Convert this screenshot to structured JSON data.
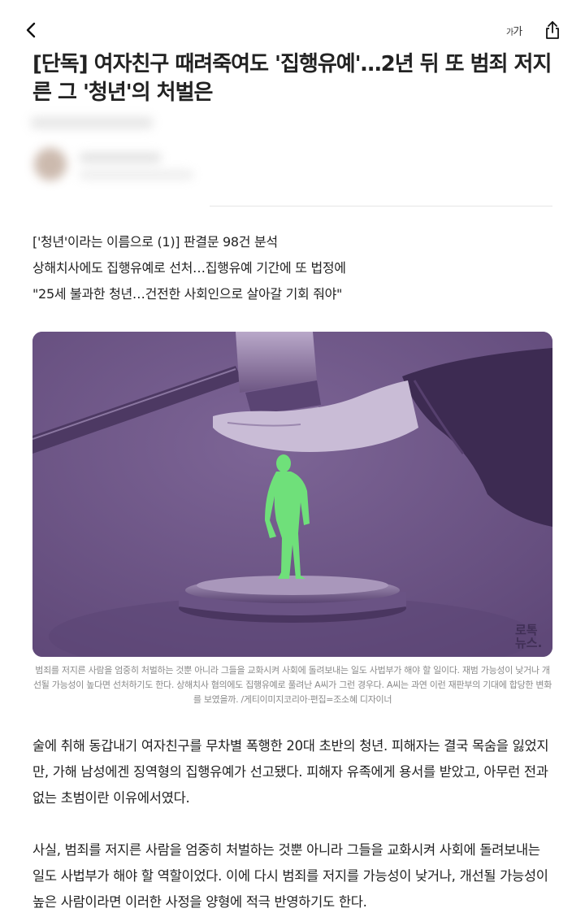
{
  "header": {
    "back_icon": "chevron-left-icon",
    "font_size_small": "가",
    "font_size_large": "가",
    "share_icon": "share-icon"
  },
  "article": {
    "title": "[단독] 여자친구 때려죽여도 '집행유예'…2년 뒤 또 범죄 저지른 그 '청년'의 처벌은",
    "subheadings": [
      "['청년'이라는 이름으로 (1)] 판결문 98건 분석",
      "상해치사에도 집행유예로 선처…집행유예 기간에 또 법정에",
      "\"25세 불과한 청년…건전한 사회인으로 살아갈 기회 줘야\""
    ],
    "image": {
      "watermark_line1": "로톡",
      "watermark_line2": "뉴스."
    },
    "caption": "범죄를 저지른 사람을 엄중히 처벌하는 것뿐 아니라 그들을 교화시켜 사회에 돌려보내는 일도 사법부가 해야 할 일이다. 재범 가능성이 낮거나 개선될 가능성이 높다면 선처하기도 한다. 상해치사 혐의에도 집행유예로 풀려난 A씨가 그런 경우다. A씨는 과연 이런 재판부의 기대에 합당한 변화를 보였을까. /게티이미지코리아·편집=조소혜 디자이너",
    "paragraphs": [
      "술에 취해 동갑내기 여자친구를 무차별 폭행한 20대 초반의 청년. 피해자는 결국 목숨을 잃었지만, 가해 남성에겐 징역형의 집행유예가 선고됐다. 피해자 유족에게 용서를 받았고, 아무런 전과 없는 초범이란 이유에서였다.",
      "사실, 범죄를 저지른 사람을 엄중히 처벌하는 것뿐 아니라 그들을 교화시켜 사회에 돌려보내는 일도 사법부가 해야 할 역할이었다. 이에 다시 범죄를 저지를 가능성이 낮거나, 개선될 가능성이 높은 사람이라면 이러한 사정을 양형에 적극 반영하기도 한다."
    ]
  },
  "colors": {
    "image_background": "#6e5588",
    "figure_green": "#6fe07a",
    "watermark_dot": "#ff4d2e"
  }
}
